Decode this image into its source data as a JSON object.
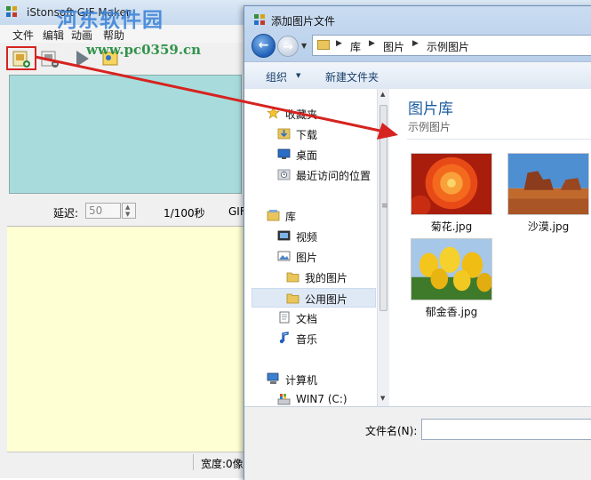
{
  "app": {
    "title": "iStonsoft GIF Maker",
    "watermark": "河东软件园",
    "watermark_url": "www.pc0359.cn",
    "menu": [
      "文件",
      "编辑",
      "动画",
      "帮助"
    ],
    "delay_label": "延迟:",
    "delay_value": "50",
    "delay_unit": "1/100秒",
    "gif_label": "GIF:",
    "status_width": "宽度:0像"
  },
  "dialog": {
    "title": "添加图片文件",
    "breadcrumb": [
      "库",
      "图片",
      "示例图片"
    ],
    "organize_label": "组织",
    "new_folder_label": "新建文件夹",
    "nav": {
      "favorites": "收藏夹",
      "downloads": "下载",
      "desktop": "桌面",
      "recent": "最近访问的位置",
      "libraries": "库",
      "videos": "视频",
      "pictures": "图片",
      "my_pictures": "我的图片",
      "public_pictures": "公用图片",
      "documents": "文档",
      "music": "音乐",
      "computer": "计算机",
      "drive_c": "WIN7 (C:)"
    },
    "library_title": "图片库",
    "library_subtitle": "示例图片",
    "files": [
      {
        "name": "菊花.jpg",
        "icon": "chrysanthemum-thumbnail"
      },
      {
        "name": "沙漠.jpg",
        "icon": "desert-thumbnail"
      },
      {
        "name": "郁金香.jpg",
        "icon": "tulips-thumbnail"
      }
    ],
    "filename_label": "文件名(N):",
    "filename_value": ""
  },
  "colors": {
    "annotation_red": "#d6231f",
    "library_title_blue": "#1c5c9f",
    "preview_cyan": "#a8dcdc",
    "frames_yellow": "#ffffd4"
  }
}
